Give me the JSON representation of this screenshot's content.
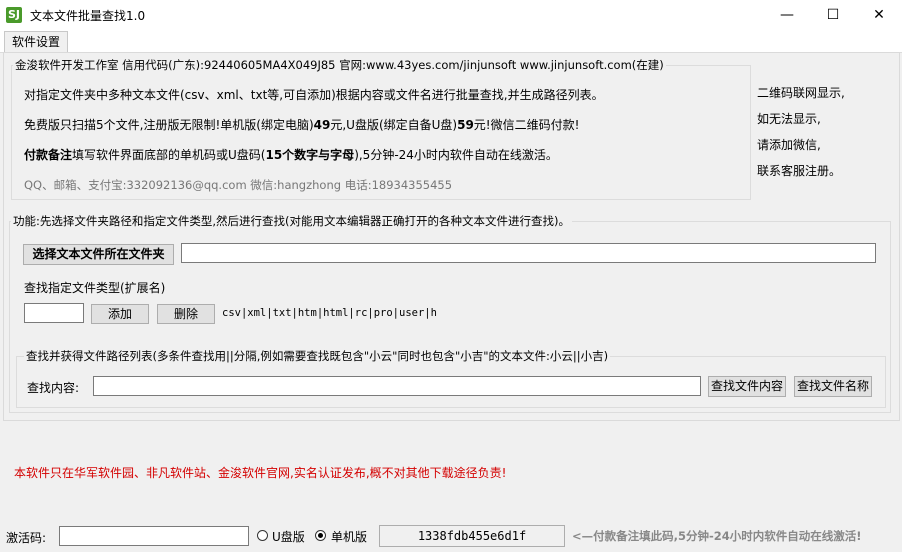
{
  "window": {
    "title": "文本文件批量查找1.0",
    "icon_text": "SJ",
    "minimize": "—",
    "maximize": "☐",
    "close": "✕"
  },
  "menu": {
    "settings": "软件设置"
  },
  "intro": {
    "legend": "金浚软件开发工作室 信用代码(广东):92440605MA4X049J85 官网:www.43yes.com/jinjunsoft  www.jinjunsoft.com(在建)",
    "line1": "对指定文件夹中多种文本文件(csv、xml、txt等,可自添加)根据内容或文件名进行批量查找,并生成路径列表。",
    "line2_pre": "免费版只扫描5个文件,注册版无限制!单机版(绑定电脑)",
    "line2_price1": "49",
    "line2_mid": "元,U盘版(绑定自备U盘)",
    "line2_price2": "59",
    "line2_post": "元!微信二维码付款!",
    "line3_bold": "付款备注",
    "line3_mid": "填写软件界面底部的单机码或U盘码(",
    "line3_bold2": "15个数字与字母",
    "line3_post": "),5分钟-24小时内软件自动在线激活。",
    "contact": "QQ、邮箱、支付宝:332092136@qq.com    微信:hangzhong    电话:18934355455"
  },
  "qr_note": [
    "二维码联网显示,",
    "如无法显示,",
    "请添加微信,",
    "联系客服注册。"
  ],
  "function_group": {
    "legend": "功能:先选择文件夹路径和指定文件类型,然后进行查找(对能用文本编辑器正确打开的各种文本文件进行查找)。",
    "select_folder_button": "选择文本文件所在文件夹",
    "folder_path_value": "",
    "file_type_label": "查找指定文件类型(扩展名)",
    "ext_input_value": "",
    "add_button": "添加",
    "delete_button": "删除",
    "ext_list": "csv|xml|txt|htm|html|rc|pro|user|h"
  },
  "search_group": {
    "legend": "查找并获得文件路径列表(多条件查找用||分隔,例如需要查找既包含\"小云\"同时也包含\"小吉\"的文本文件:小云||小吉)",
    "content_label": "查找内容:",
    "content_value": "",
    "find_content_button": "查找文件内容",
    "find_name_button": "查找文件名称"
  },
  "disclaimer": "本软件只在华军软件园、非凡软件站、金浚软件官网,实名认证发布,概不对其他下载途径负责!",
  "bottom": {
    "activation_label": "激活码:",
    "activation_value": "",
    "usb_option": "U盘版",
    "standalone_option": "单机版",
    "selected": "standalone",
    "machine_code": "1338fdb455e6d1f",
    "hint": "<—付款备注填此码,5分钟-24小时内软件自动在线激活!"
  },
  "colors": {
    "price": "#000000",
    "disclaimer": "#d40000",
    "hint": "#888888"
  }
}
